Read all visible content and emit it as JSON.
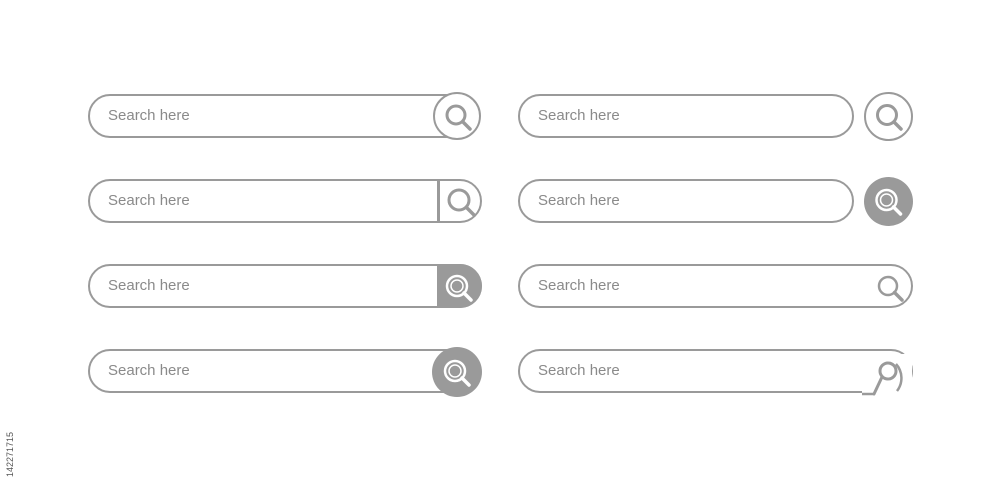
{
  "search_bars": [
    {
      "placeholder": "Search here"
    },
    {
      "placeholder": "Search here"
    },
    {
      "placeholder": "Search here"
    },
    {
      "placeholder": "Search here"
    },
    {
      "placeholder": "Search here"
    },
    {
      "placeholder": "Search here"
    },
    {
      "placeholder": "Search here"
    },
    {
      "placeholder": "Search here"
    }
  ],
  "icons": {
    "search": "magnifier-icon"
  },
  "colors": {
    "stroke": "#9a9a9a",
    "text": "#8a8a8a",
    "background": "#ffffff"
  },
  "stock_id": "142271715"
}
